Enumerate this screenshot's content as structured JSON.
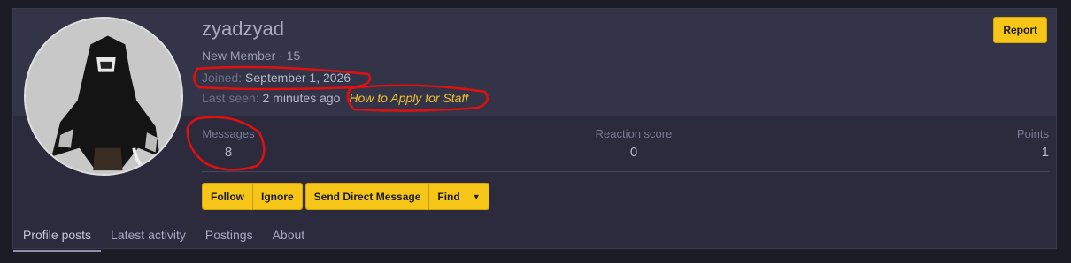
{
  "profile": {
    "username": "zyadzyad",
    "user_title": "New Member · 15",
    "joined_label": "Joined:",
    "joined_value": "September 1, 2026",
    "last_seen_label": "Last seen:",
    "last_seen_value": "2 minutes ago",
    "last_seen_activity": "How to Apply for Staff"
  },
  "header": {
    "report_label": "Report"
  },
  "stats": {
    "messages_label": "Messages",
    "messages_value": "8",
    "reaction_label": "Reaction score",
    "reaction_value": "0",
    "points_label": "Points",
    "points_value": "1"
  },
  "actions": {
    "follow": "Follow",
    "ignore": "Ignore",
    "send_dm": "Send Direct Message",
    "find": "Find"
  },
  "tabs": [
    {
      "label": "Profile posts",
      "active": true
    },
    {
      "label": "Latest activity",
      "active": false
    },
    {
      "label": "Postings",
      "active": false
    },
    {
      "label": "About",
      "active": false
    }
  ],
  "colors": {
    "page_bg": "#1c1c26",
    "card_bg": "#2b2b3d",
    "card_top_bg": "#343448",
    "accent_button": "#f5c518",
    "link_activity": "#f2c12e",
    "annotation": "#e01010"
  },
  "icons": {
    "find_dropdown": "caret-down-icon"
  }
}
